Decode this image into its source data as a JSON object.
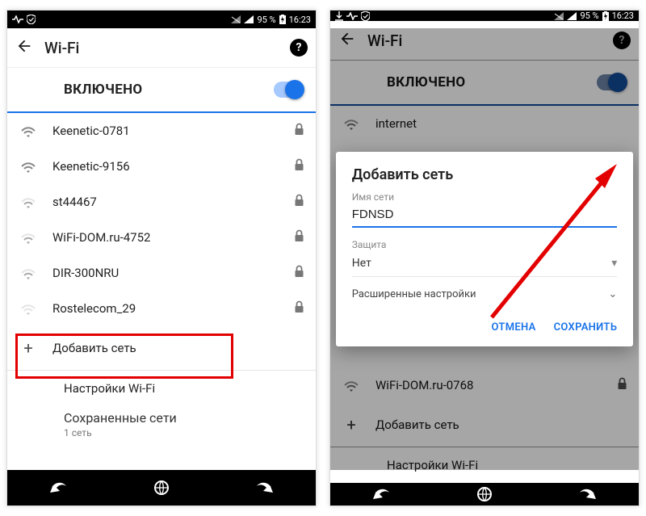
{
  "status": {
    "battery": "95 %",
    "time": "16:23"
  },
  "left": {
    "title": "Wi-Fi",
    "master_label": "ВКЛЮЧЕНО",
    "networks": [
      {
        "ssid": "Keenetic-0781",
        "locked": true,
        "signal": 2
      },
      {
        "ssid": "Keenetic-9156",
        "locked": true,
        "signal": 2
      },
      {
        "ssid": "st44467",
        "locked": true,
        "signal": 1
      },
      {
        "ssid": "WiFi-DOM.ru-4752",
        "locked": true,
        "signal": 1
      },
      {
        "ssid": "DIR-300NRU",
        "locked": true,
        "signal": 1
      },
      {
        "ssid": "Rostelecom_29",
        "locked": true,
        "signal": 0
      }
    ],
    "add_label": "Добавить сеть",
    "prefs_label": "Настройки Wi-Fi",
    "saved_label": "Сохраненные сети",
    "saved_count": "1 сеть"
  },
  "right": {
    "title": "Wi-Fi",
    "master_label": "ВКЛЮЧЕНО",
    "visible_rows": [
      {
        "ssid": "internet",
        "locked": false
      }
    ],
    "below_rows": [
      {
        "ssid": "WiFi-DOM.ru-0768",
        "locked": true
      }
    ],
    "add_label": "Добавить сеть",
    "prefs_label": "Настройки Wi-Fi",
    "dialog": {
      "title": "Добавить сеть",
      "name_label": "Имя сети",
      "name_value": "FDNSD",
      "security_label": "Защита",
      "security_value": "Нет",
      "advanced": "Расширенные настройки",
      "cancel": "ОТМЕНА",
      "save": "СОХРАНИТЬ"
    }
  }
}
